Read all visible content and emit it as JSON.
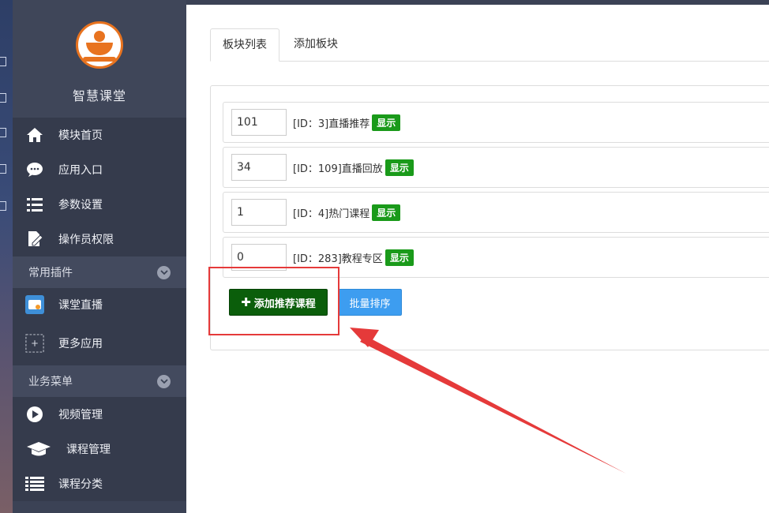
{
  "brand": {
    "title": "智慧课堂"
  },
  "nav": {
    "items": [
      {
        "label": "模块首页",
        "icon": "home-icon"
      },
      {
        "label": "应用入口",
        "icon": "chat-icon"
      },
      {
        "label": "参数设置",
        "icon": "list-icon"
      },
      {
        "label": "操作员权限",
        "icon": "edit-doc-icon"
      }
    ],
    "plugins": {
      "title": "常用插件",
      "items": [
        {
          "label": "课堂直播",
          "icon": "live-tv-icon"
        },
        {
          "label": "更多应用",
          "icon": "plus-box-icon"
        }
      ]
    },
    "business": {
      "title": "业务菜单",
      "items": [
        {
          "label": "视频管理",
          "icon": "play-icon"
        },
        {
          "label": "课程管理",
          "icon": "graduation-cap-icon"
        },
        {
          "label": "课程分类",
          "icon": "list-menu-icon"
        }
      ]
    }
  },
  "tabs": [
    {
      "label": "板块列表",
      "active": true
    },
    {
      "label": "添加板块",
      "active": false
    }
  ],
  "rows": [
    {
      "order": "101",
      "label": "[ID：3]直播推荐",
      "badge": "显示"
    },
    {
      "order": "34",
      "label": "[ID：109]直播回放",
      "badge": "显示"
    },
    {
      "order": "1",
      "label": "[ID：4]热门课程",
      "badge": "显示"
    },
    {
      "order": "0",
      "label": "[ID：283]教程专区",
      "badge": "显示"
    }
  ],
  "actions": {
    "add_label": "添加推荐课程",
    "sort_label": "批量排序"
  },
  "colors": {
    "sidebar": "#3b4255",
    "badge_green": "#1a9a1a",
    "add_button": "#0b5e0b",
    "sort_button": "#3d9df0",
    "annotation_red": "#e53a3a",
    "logo_orange": "#e8731f"
  }
}
